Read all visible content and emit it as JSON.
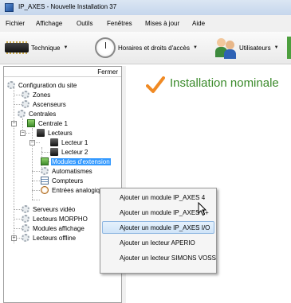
{
  "window": {
    "title": "IP_AXES - Nouvelle Installation 37"
  },
  "menu": [
    "Fichier",
    "Affichage",
    "Outils",
    "Fenêtres",
    "Mises à jour",
    "Aide"
  ],
  "toolbar": {
    "technique": "Technique",
    "horaires": "Horaires et droits d'accès",
    "utilisateurs": "Utilisateurs"
  },
  "panel": {
    "close_label": "Fermer"
  },
  "tree": [
    "Configuration du site",
    "Zones",
    "Ascenseurs",
    "Centrales",
    "Centrale 1",
    "Lecteurs",
    "Lecteur 1",
    "Lecteur 2",
    "Modules d'extension",
    "Automatismes",
    "Compteurs",
    "Entrées analogiques",
    "Serveurs vidéo",
    "Lecteurs MORPHO",
    "Modules affichage",
    "Lecteurs offline"
  ],
  "status": {
    "text": "Installation nominale",
    "color": "#3a8a2a"
  },
  "context_menu": [
    "Ajouter un module IP_AXES 4",
    "Ajouter un module IP_AXES 4+",
    "Ajouter un module IP_AXES I/O",
    "Ajouter un lecteur APERIO",
    "Ajouter un lecteur SIMONS VOSS"
  ],
  "highlight_color": "#3399ff"
}
